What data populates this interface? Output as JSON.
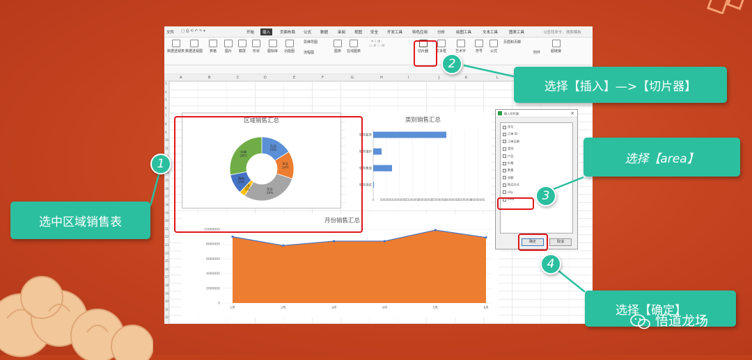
{
  "menu": {
    "tabs": [
      "文件",
      "开始",
      "插入",
      "页面布局",
      "公式",
      "数据",
      "审阅",
      "视图",
      "安全",
      "开发工具",
      "特色应用",
      "分析",
      "绘图工具",
      "文本工具",
      "图表工具"
    ],
    "active_tab": "插入",
    "search_placeholder": "Q查找命令、搜索模板"
  },
  "ribbon": {
    "buttons": [
      "数据透视表",
      "数据透视图",
      "表格",
      "图片",
      "截屏",
      "形状",
      "图标库",
      "功能图",
      "思维导图",
      "流程图",
      "图表",
      "在线图表",
      "切片器",
      "文本框",
      "艺术字",
      "符号",
      "公式",
      "页眉和页脚",
      "附件",
      "超链接"
    ],
    "slicer_label": "切片器"
  },
  "sheet": {
    "columns": [
      "A",
      "B",
      "C",
      "D",
      "E",
      "F",
      "G",
      "H",
      "I",
      "J",
      "K",
      "L"
    ],
    "rows": [
      "3",
      "4",
      "5",
      "6",
      "7",
      "8",
      "9",
      "10",
      "11",
      "12",
      "13",
      "14",
      "15",
      "16",
      "17",
      "18",
      "19",
      "20",
      "21",
      "22",
      "23",
      "24",
      "25",
      "26",
      "27",
      "28",
      "29",
      "30",
      "31",
      "32"
    ]
  },
  "charts": {
    "region_title": "区域销售汇总",
    "category_title": "类别销售汇总",
    "monthly_title": "月份销售汇总"
  },
  "chart_data": [
    {
      "type": "pie",
      "title": "区域销售汇总",
      "categories": [
        "东北",
        "华北",
        "华东",
        "西北",
        "西南",
        "中南"
      ],
      "values": [
        16,
        14,
        29,
        3,
        10,
        28
      ],
      "labels": [
        "东北 16%",
        "华北 14%",
        "华东 29%",
        "西北 3%",
        "西南 10%",
        "中南 28%"
      ],
      "colors": [
        "#5b8fd6",
        "#ed7d31",
        "#a5a5a5",
        "#ffc000",
        "#4472c4",
        "#70ad47"
      ]
    },
    {
      "type": "bar",
      "title": "类别销售汇总",
      "categories": [
        "软件服务",
        "软件维护",
        "软件集成",
        "软件测试"
      ],
      "values": [
        28000000,
        3200000,
        7200000,
        300000
      ],
      "tick_labels": [
        "0",
        "5000000",
        "10000000",
        "15000000",
        "20000000",
        "25000000",
        "30000000",
        "35000000",
        "40000000"
      ],
      "xlim": [
        0,
        40000000
      ]
    },
    {
      "type": "area",
      "title": "月份销售汇总",
      "categories": [
        "1月",
        "2月",
        "3月",
        "4月",
        "5月",
        "6月"
      ],
      "values": [
        9000000,
        7800000,
        8400000,
        8400000,
        9900000,
        8900000
      ],
      "tick_labels": [
        "0",
        "2000000",
        "4000000",
        "6000000",
        "8000000",
        "10000000"
      ],
      "ylim": [
        0,
        10000000
      ]
    }
  ],
  "dialog": {
    "title": "插入切片器",
    "fields": [
      "序号",
      "订单 ID",
      "订单日期",
      "类别",
      "产品",
      "价格",
      "数量",
      "金额",
      "购买方式",
      "city",
      "area"
    ],
    "checked": "area",
    "ok_label": "确定",
    "cancel_label": "取消"
  },
  "callouts": {
    "step1": "选中区域销售表",
    "step2": "选择【插入】—>【切片器】",
    "step3": "选择【area】",
    "step4": "选择【确定】"
  },
  "numbers": [
    "1",
    "2",
    "3",
    "4"
  ],
  "brand": "悟道龙场",
  "colors": {
    "accent": "#2bbf9f",
    "highlight": "#e01418",
    "background": "#c44320"
  }
}
